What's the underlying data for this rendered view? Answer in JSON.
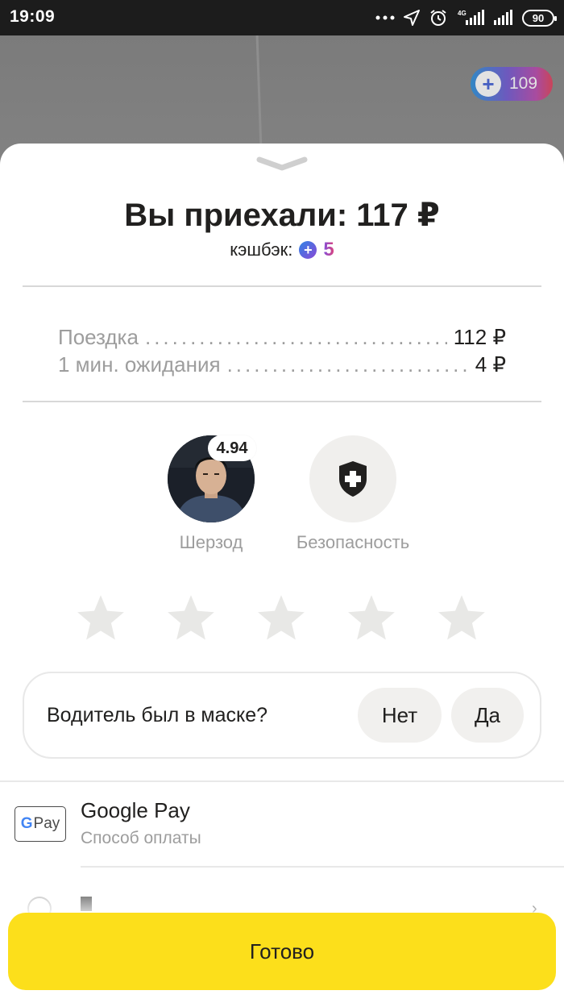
{
  "status_bar": {
    "time": "19:09",
    "battery": "90",
    "network": "4G",
    "icons": [
      "more-dots-icon",
      "location-arrow-icon",
      "alarm-icon",
      "signal-icon",
      "signal-icon",
      "battery-icon"
    ]
  },
  "plus_badge": {
    "icon": "plus-points-icon",
    "points": "109"
  },
  "trip": {
    "title": "Вы приехали: 117 ₽",
    "cashback_label": "кэшбэк:",
    "cashback_value": "5",
    "cashback_icon": "plus-points-icon"
  },
  "breakdown": [
    {
      "label": "Поездка",
      "amount": "112 ₽"
    },
    {
      "label": "1 мин. ожидания",
      "amount": "4 ₽"
    }
  ],
  "driver": {
    "name": "Шерзод",
    "rating": "4.94"
  },
  "safety": {
    "label": "Безопасность",
    "icon": "shield-plus-icon"
  },
  "rating_stars": {
    "count": 5,
    "selected": 0,
    "color": "#e8e8e6"
  },
  "mask_question": {
    "question": "Водитель был в маске?",
    "no_label": "Нет",
    "yes_label": "Да"
  },
  "payment": {
    "method": "Google Pay",
    "subtitle": "Способ оплаты",
    "logo_g": "G",
    "logo_pay": "Pay"
  },
  "footer": {
    "done_label": "Готово",
    "accent_color": "#fcdf1b"
  }
}
